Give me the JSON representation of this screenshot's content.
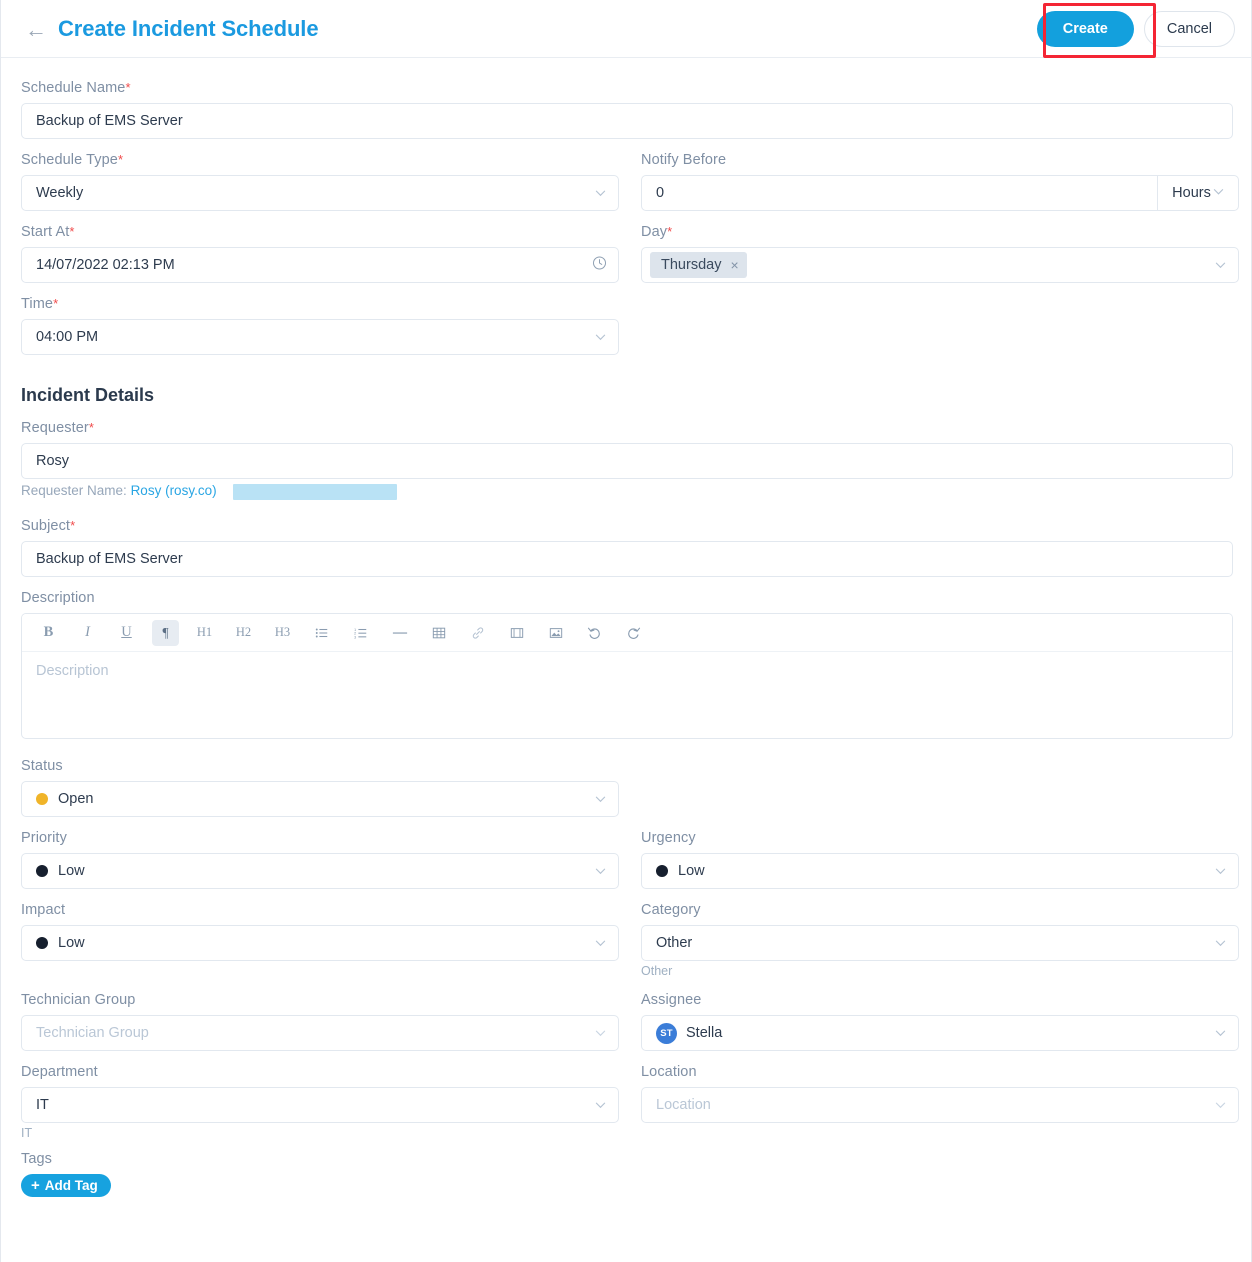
{
  "header": {
    "back_icon": "arrow-left-icon",
    "title": "Create Incident Schedule",
    "create_label": "Create",
    "cancel_label": "Cancel",
    "annotation_color": "#f42534",
    "accent_color": "#13a0dd"
  },
  "schedule": {
    "name_label": "Schedule Name",
    "name_value": "Backup of EMS Server",
    "type_label": "Schedule Type",
    "type_value": "Weekly",
    "start_label": "Start At",
    "start_value": "14/07/2022 02:13 PM",
    "time_label": "Time",
    "time_value": "04:00 PM",
    "notify_label": "Notify Before",
    "notify_value": "0",
    "notify_unit": "Hours",
    "day_label": "Day",
    "day_chip": "Thursday",
    "day_chip_remove": "×"
  },
  "incident": {
    "section_title": "Incident Details",
    "requester_label": "Requester",
    "requester_value": "Rosy",
    "requester_note_prefix": "Requester Name: ",
    "requester_note_link": "Rosy (rosy.co",
    "requester_note_suffix": ")",
    "subject_label": "Subject",
    "subject_value": "Backup of EMS Server",
    "description_label": "Description",
    "description_placeholder": "Description",
    "toolbar": [
      {
        "name": "bold-icon",
        "label": "B"
      },
      {
        "name": "italic-icon",
        "label": "I"
      },
      {
        "name": "underline-icon",
        "label": "U"
      },
      {
        "name": "paragraph-icon",
        "label": "¶"
      },
      {
        "name": "heading-1-icon",
        "label": "H1"
      },
      {
        "name": "heading-2-icon",
        "label": "H2"
      },
      {
        "name": "heading-3-icon",
        "label": "H3"
      },
      {
        "name": "bullet-list-icon",
        "label": ""
      },
      {
        "name": "numbered-list-icon",
        "label": ""
      },
      {
        "name": "horizontal-rule-icon",
        "label": ""
      },
      {
        "name": "table-icon",
        "label": ""
      },
      {
        "name": "link-icon",
        "label": ""
      },
      {
        "name": "video-icon",
        "label": ""
      },
      {
        "name": "image-icon",
        "label": ""
      },
      {
        "name": "undo-icon",
        "label": ""
      },
      {
        "name": "redo-icon",
        "label": ""
      }
    ],
    "status_label": "Status",
    "status_value": "Open",
    "status_color": "#f0b429",
    "priority_label": "Priority",
    "priority_value": "Low",
    "priority_color": "#161f2e",
    "urgency_label": "Urgency",
    "urgency_value": "Low",
    "urgency_color": "#161f2e",
    "impact_label": "Impact",
    "impact_value": "Low",
    "impact_color": "#161f2e",
    "category_label": "Category",
    "category_value": "Other",
    "category_helper": "Other",
    "technician_group_label": "Technician Group",
    "technician_group_placeholder": "Technician Group",
    "assignee_label": "Assignee",
    "assignee_value": "Stella",
    "assignee_initials": "ST",
    "assignee_avatar_color": "#3b7dd8",
    "department_label": "Department",
    "department_value": "IT",
    "department_helper": "IT",
    "location_label": "Location",
    "location_placeholder": "Location",
    "tags_label": "Tags",
    "add_tag_label": "Add Tag",
    "add_tag_plus": "+"
  }
}
